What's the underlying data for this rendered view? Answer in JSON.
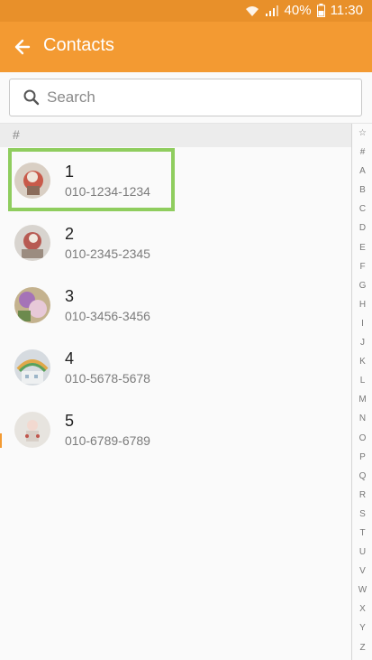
{
  "status_bar": {
    "battery": "40%",
    "time": "11:30"
  },
  "app_bar": {
    "title": "Contacts"
  },
  "search": {
    "placeholder": "Search"
  },
  "section_header": "#",
  "contacts": [
    {
      "name": "1",
      "phone": "010-1234-1234",
      "avatar": "avatar-1"
    },
    {
      "name": "2",
      "phone": "010-2345-2345",
      "avatar": "avatar-2"
    },
    {
      "name": "3",
      "phone": "010-3456-3456",
      "avatar": "avatar-3"
    },
    {
      "name": "4",
      "phone": "010-5678-5678",
      "avatar": "avatar-4"
    },
    {
      "name": "5",
      "phone": "010-6789-6789",
      "avatar": "avatar-5"
    }
  ],
  "index_letters": [
    "☆",
    "#",
    "A",
    "B",
    "C",
    "D",
    "E",
    "F",
    "G",
    "H",
    "I",
    "J",
    "K",
    "L",
    "M",
    "N",
    "O",
    "P",
    "Q",
    "R",
    "S",
    "T",
    "U",
    "V",
    "W",
    "X",
    "Y",
    "Z"
  ],
  "colors": {
    "app_bar": "#f39a32",
    "status_bar": "#e8902a",
    "highlight": "#8fcd5e"
  }
}
